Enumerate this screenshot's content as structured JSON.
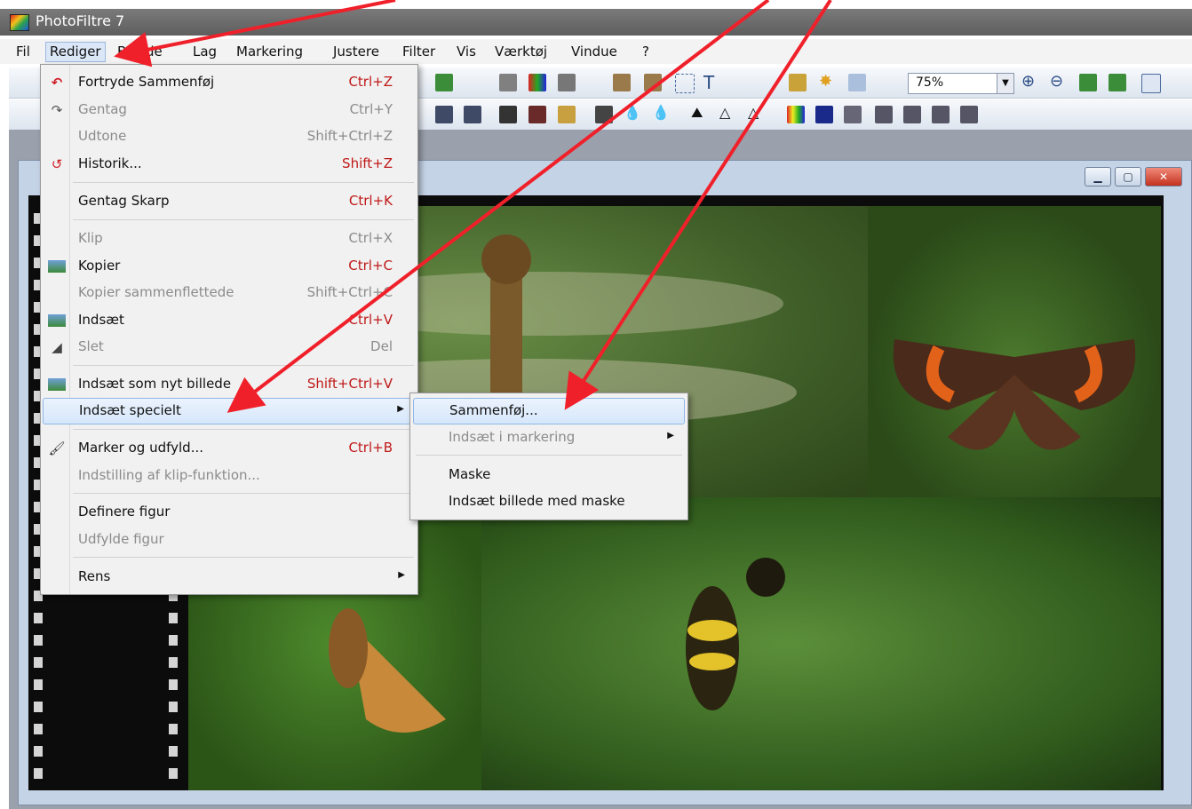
{
  "app": {
    "title": "PhotoFiltre 7"
  },
  "menubar": {
    "items": [
      "Fil",
      "Rediger",
      "Billede",
      "Lag",
      "Markering",
      "Justere",
      "Filter",
      "Vis",
      "Værktøj",
      "Vindue",
      "?"
    ]
  },
  "toolbar": {
    "zoom_value": "75%"
  },
  "edit_menu": {
    "items": [
      {
        "label": "Fortryde Sammenføj",
        "shortcut": "Ctrl+Z",
        "enabled": true,
        "icon": "undo-icon"
      },
      {
        "label": "Gentag",
        "shortcut": "Ctrl+Y",
        "enabled": false,
        "icon": "redo-icon"
      },
      {
        "label": "Udtone",
        "shortcut": "Shift+Ctrl+Z",
        "enabled": false
      },
      {
        "label": "Historik...",
        "shortcut": "Shift+Z",
        "enabled": true,
        "icon": "history-icon"
      },
      {
        "label": "Gentag Skarp",
        "shortcut": "Ctrl+K",
        "enabled": true
      },
      {
        "label": "Klip",
        "shortcut": "Ctrl+X",
        "enabled": false
      },
      {
        "label": "Kopier",
        "shortcut": "Ctrl+C",
        "enabled": true,
        "icon": "copy-icon"
      },
      {
        "label": "Kopier sammenflettede",
        "shortcut": "Shift+Ctrl+C",
        "enabled": false
      },
      {
        "label": "Indsæt",
        "shortcut": "Ctrl+V",
        "enabled": true,
        "icon": "paste-icon"
      },
      {
        "label": "Slet",
        "shortcut": "Del",
        "enabled": false,
        "icon": "eraser-icon"
      },
      {
        "label": "Indsæt som nyt billede",
        "shortcut": "Shift+Ctrl+V",
        "enabled": true,
        "icon": "paste-new-icon"
      },
      {
        "label": "Indsæt specielt",
        "shortcut": "",
        "enabled": true,
        "submenu": true
      },
      {
        "label": "Marker og udfyld...",
        "shortcut": "Ctrl+B",
        "enabled": true,
        "icon": "fill-icon"
      },
      {
        "label": "Indstilling af klip-funktion...",
        "shortcut": "",
        "enabled": false
      },
      {
        "label": "Definere figur",
        "shortcut": "",
        "enabled": true
      },
      {
        "label": "Udfylde figur",
        "shortcut": "",
        "enabled": false
      },
      {
        "label": "Rens",
        "shortcut": "",
        "enabled": true,
        "submenu": true
      }
    ]
  },
  "paste_special_menu": {
    "items": [
      {
        "label": "Sammenføj...",
        "enabled": true
      },
      {
        "label": "Indsæt i markering",
        "enabled": false,
        "submenu": true
      },
      {
        "label": "Maske",
        "enabled": true
      },
      {
        "label": "Indsæt billede med maske",
        "enabled": true
      }
    ]
  },
  "colors": {
    "annotation_arrow": "#f0202a",
    "highlight": "#d6e7fb",
    "shortcut_red": "#c01818"
  }
}
